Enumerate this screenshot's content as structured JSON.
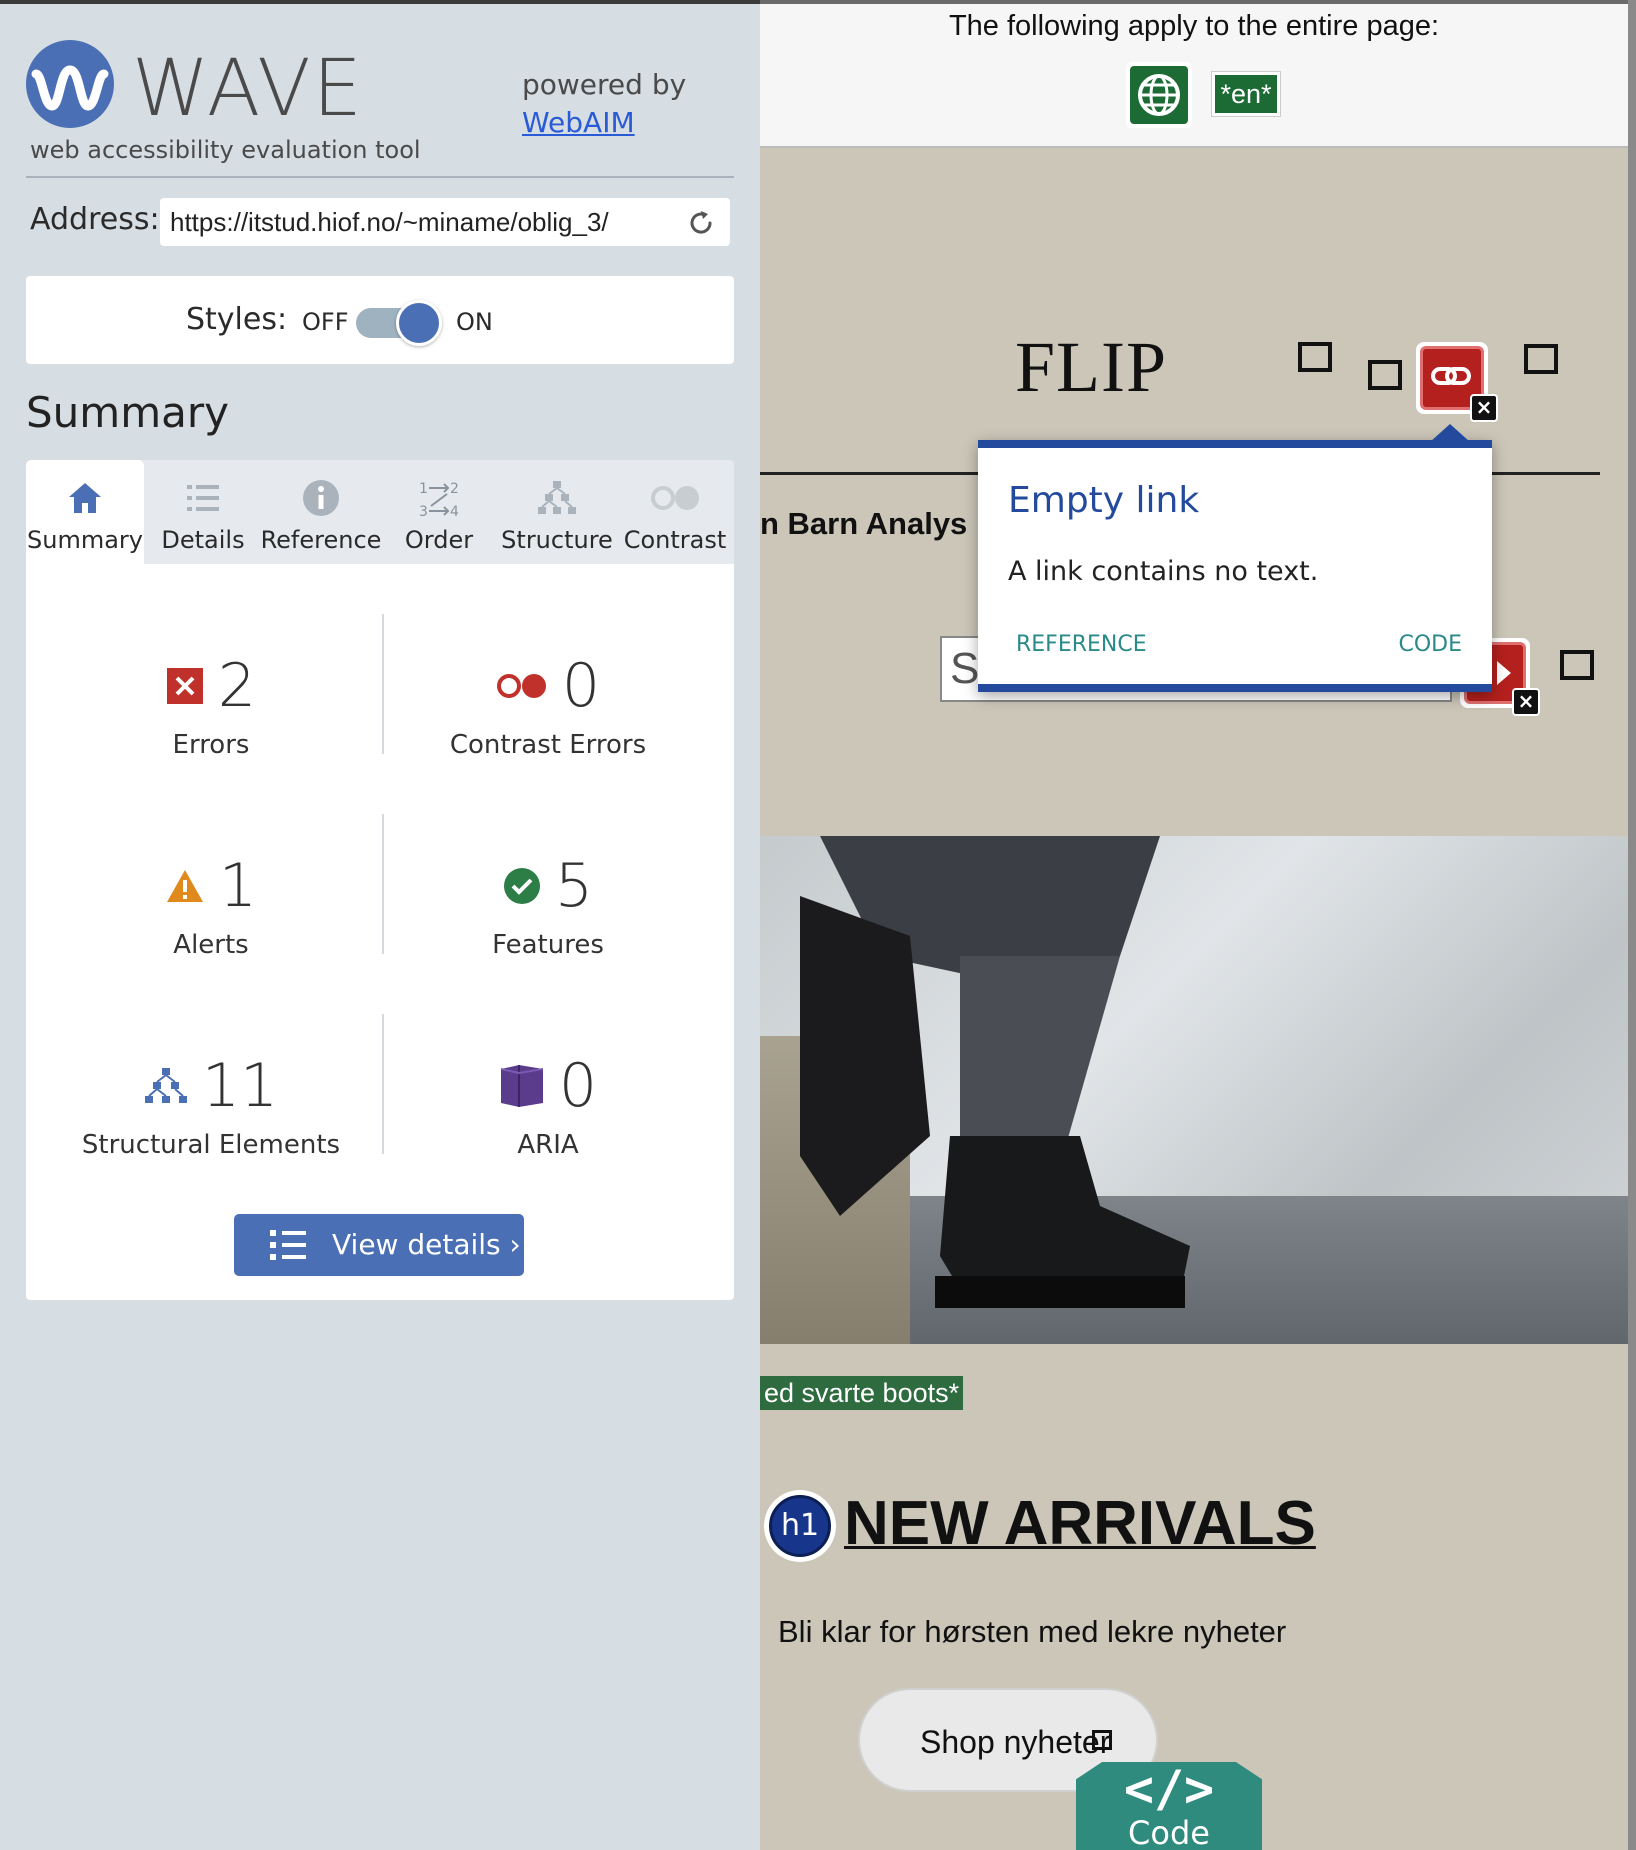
{
  "sidebar": {
    "logo_text": "WAVE",
    "logo_subtitle": "web accessibility evaluation tool",
    "powered_by": "powered by",
    "powered_link": "WebAIM",
    "address_label": "Address:",
    "address_value": "https://itstud.hiof.no/~miname/oblig_3/",
    "styles_label": "Styles:",
    "styles_off": "OFF",
    "styles_on": "ON",
    "styles_enabled": true,
    "section_title": "Summary",
    "tabs": [
      {
        "label": "Summary",
        "icon": "home-icon",
        "active": true
      },
      {
        "label": "Details",
        "icon": "list-icon",
        "active": false
      },
      {
        "label": "Reference",
        "icon": "info-icon",
        "active": false
      },
      {
        "label": "Order",
        "icon": "order-icon",
        "active": false
      },
      {
        "label": "Structure",
        "icon": "structure-icon",
        "active": false
      },
      {
        "label": "Contrast",
        "icon": "contrast-icon",
        "active": false
      }
    ],
    "stats": {
      "errors": {
        "value": "2",
        "label": "Errors",
        "color": "#c0312b"
      },
      "contrast": {
        "value": "0",
        "label": "Contrast Errors",
        "color": "#c0312b"
      },
      "alerts": {
        "value": "1",
        "label": "Alerts",
        "color": "#e08a1e"
      },
      "features": {
        "value": "5",
        "label": "Features",
        "color": "#2d7d46"
      },
      "structural": {
        "value": "11",
        "label": "Structural Elements",
        "color": "#4a6fb5"
      },
      "aria": {
        "value": "0",
        "label": "ARIA",
        "color": "#5a3b8c"
      }
    },
    "view_details": "View details ›",
    "accent": "#4a6fb5"
  },
  "page": {
    "document_note": "The following apply to the entire page:",
    "lang_tag": "*en*",
    "site_logo": "FLIP",
    "nav_text": "n  Barn  Analys",
    "search_placeholder": "S",
    "popup": {
      "title": "Empty link",
      "description": "A link contains no text.",
      "reference": "REFERENCE",
      "code": "CODE"
    },
    "alt_text": "ed svarte boots*",
    "h1_badge": "h1",
    "heading": "NEW ARRIVALS",
    "subheading": "Bli klar for hørsten med lekre nyheter",
    "shop_button": "Shop nyheter",
    "code_tab_glyph": "</>",
    "code_tab_label": "Code"
  }
}
